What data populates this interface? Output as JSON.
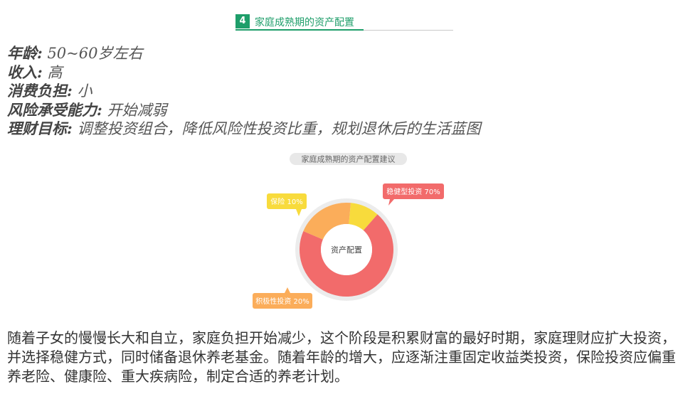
{
  "section": {
    "number": "4",
    "title": "家庭成熟期的资产配置"
  },
  "profile": [
    {
      "key": "年龄:",
      "value": " 50~60岁左右"
    },
    {
      "key": "收入:",
      "value": " 高"
    },
    {
      "key": "消费负担:",
      "value": " 小"
    },
    {
      "key": "风险承受能力:",
      "value": " 开始减弱"
    },
    {
      "key": "理财目标:",
      "value": " 调整投资组合，降低风险性投资比重，规划退休后的生活蓝图"
    }
  ],
  "chart_data": {
    "type": "pie",
    "title": "家庭成熟期的资产配置建议",
    "center_label": "资产配置",
    "slices": [
      {
        "name": "稳健型投资",
        "value": 70,
        "label": "稳健型投资 70%",
        "color": "#f26b6b"
      },
      {
        "name": "积极性投资",
        "value": 20,
        "label": "积极性投资 20%",
        "color": "#fbad5a"
      },
      {
        "name": "保险",
        "value": 10,
        "label": "保险 10%",
        "color": "#f8db3c"
      }
    ]
  },
  "paragraph": "随着子女的慢慢长大和自立，家庭负担开始减少，这个阶段是积累财富的最好时期，家庭理财应扩大投资，并选择稳健方式，同时储备退休养老基金。随着年龄的增大，应逐渐注重固定收益类投资，保险投资应偏重养老险、健康险、重大疾病险，制定合适的养老计划。"
}
